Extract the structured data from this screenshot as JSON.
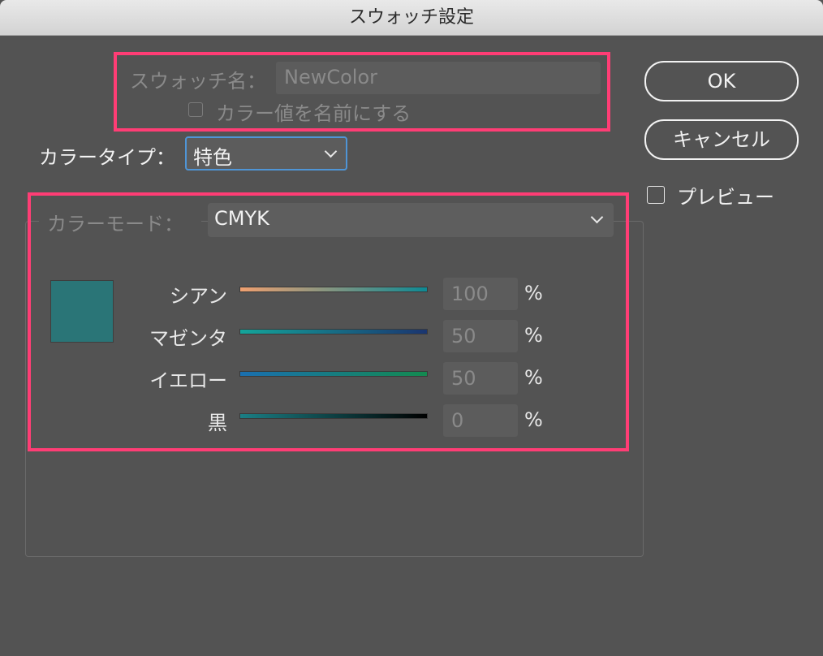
{
  "window": {
    "title": "スウォッチ設定"
  },
  "swatch_name": {
    "label": "スウォッチ名：",
    "placeholder": "NewColor",
    "name_by_value_label": "カラー値を名前にする",
    "name_by_value_checked": false
  },
  "color_type": {
    "label": "カラータイプ：",
    "value": "特色"
  },
  "color_mode": {
    "label": "カラーモード：",
    "value": "CMYK"
  },
  "buttons": {
    "ok": "OK",
    "cancel": "キャンセル"
  },
  "preview": {
    "label": "プレビュー",
    "checked": false
  },
  "swatch_preview_color": "#2a7577",
  "highlight_color": "#ff3d75",
  "sliders": [
    {
      "label": "シアン",
      "value": "100",
      "unit": "%",
      "gradient": [
        "#f0a070",
        "#0e8a94"
      ]
    },
    {
      "label": "マゼンタ",
      "value": "50",
      "unit": "%",
      "gradient": [
        "#14a59a",
        "#1a3570"
      ]
    },
    {
      "label": "イエロー",
      "value": "50",
      "unit": "%",
      "gradient": [
        "#1a6fb0",
        "#138a50"
      ]
    },
    {
      "label": "黒",
      "value": "0",
      "unit": "%",
      "gradient": [
        "#1b7f85",
        "#000000"
      ]
    }
  ]
}
